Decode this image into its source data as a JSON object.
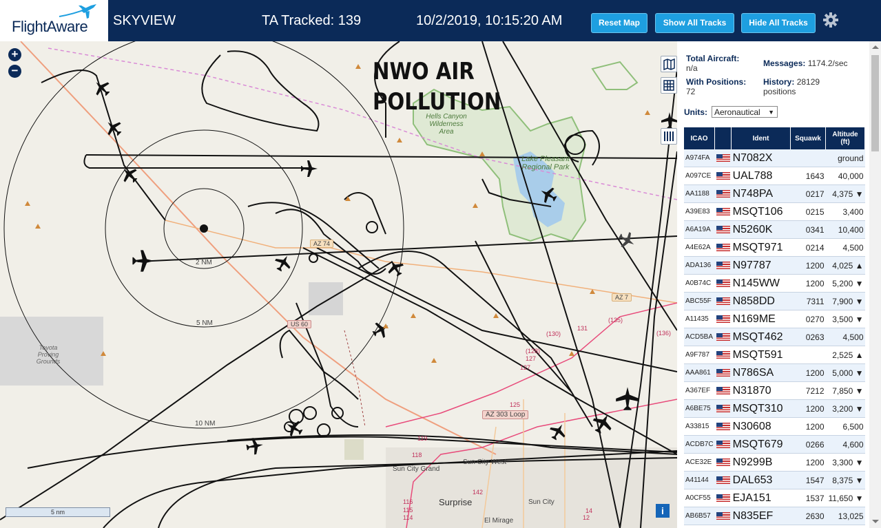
{
  "header": {
    "logo_text": "FlightAware",
    "site_name": "SKYVIEW",
    "tracked": "TA Tracked: 139",
    "datetime": "10/2/2019, 10:15:20 AM",
    "buttons": {
      "reset": "Reset Map",
      "show": "Show All Tracks",
      "hide": "Hide All Tracks"
    }
  },
  "map": {
    "zoom_in": "+",
    "zoom_out": "−",
    "overlay_line1": "NWO AIR",
    "overlay_line2": "POLLUTION",
    "ring_labels": {
      "r2": "2 NM",
      "r5": "5 NM",
      "r10": "10 NM"
    },
    "places": {
      "hells_canyon": "Hells Canyon Wilderness Area",
      "lake_pleasant": "Lake Pleasant Regional Park",
      "toyota": "Toyota Proving Grounds",
      "sun_city_grand": "Sun City Grand",
      "sun_city_west": "Sun City West",
      "sun_city": "Sun City",
      "surprise": "Surprise",
      "el_mirage": "El Mirage"
    },
    "roads": {
      "az74": "AZ 74",
      "az74b": "AZ 7",
      "us60": "US 60",
      "az303": "AZ 303 Loop",
      "r135": "(135)",
      "r131": "131",
      "r136": "(136)",
      "r130": "(130)",
      "r128": "(128)",
      "r127a": "127",
      "r127b": "127",
      "r125": "125",
      "r119": "119",
      "r118": "118",
      "r116": "116",
      "r115": "115",
      "r114": "114",
      "r142": "142",
      "r14": "14",
      "r12": "12"
    },
    "scale": "5 nm",
    "info": "i"
  },
  "panel": {
    "total_label": "Total Aircraft:",
    "total_value": "n/a",
    "messages_label": "Messages:",
    "messages_value": "1174.2/sec",
    "positions_label": "With Positions:",
    "positions_value": "72",
    "history_label": "History:",
    "history_value": "28129",
    "history_unit": "positions",
    "units_label": "Units:",
    "units_value": "Aeronautical",
    "columns": {
      "icao": "ICAO",
      "ident": "Ident",
      "squawk": "Squawk",
      "altitude": "Altitude",
      "alt_unit": "(ft)"
    },
    "rows": [
      {
        "icao": "A974FA",
        "ident": "N7082X",
        "squawk": "",
        "alt": "ground"
      },
      {
        "icao": "A097CE",
        "ident": "UAL788",
        "squawk": "1643",
        "alt": "40,000"
      },
      {
        "icao": "AA1188",
        "ident": "N748PA",
        "squawk": "0217",
        "alt": "4,375 ▼"
      },
      {
        "icao": "A39E83",
        "ident": "MSQT106",
        "squawk": "0215",
        "alt": "3,400"
      },
      {
        "icao": "A6A19A",
        "ident": "N5260K",
        "squawk": "0341",
        "alt": "10,400"
      },
      {
        "icao": "A4E62A",
        "ident": "MSQT971",
        "squawk": "0214",
        "alt": "4,500"
      },
      {
        "icao": "ADA136",
        "ident": "N97787",
        "squawk": "1200",
        "alt": "4,025 ▲"
      },
      {
        "icao": "A0B74C",
        "ident": "N145WW",
        "squawk": "1200",
        "alt": "5,200 ▼"
      },
      {
        "icao": "ABC55F",
        "ident": "N858DD",
        "squawk": "7311",
        "alt": "7,900 ▼"
      },
      {
        "icao": "A11435",
        "ident": "N169ME",
        "squawk": "0270",
        "alt": "3,500 ▼"
      },
      {
        "icao": "ACD5BA",
        "ident": "MSQT462",
        "squawk": "0263",
        "alt": "4,500"
      },
      {
        "icao": "A9F787",
        "ident": "MSQT591",
        "squawk": "",
        "alt": "2,525 ▲"
      },
      {
        "icao": "AAA861",
        "ident": "N786SA",
        "squawk": "1200",
        "alt": "5,000 ▼"
      },
      {
        "icao": "A367EF",
        "ident": "N31870",
        "squawk": "7212",
        "alt": "7,850 ▼"
      },
      {
        "icao": "A6BE75",
        "ident": "MSQT310",
        "squawk": "1200",
        "alt": "3,200 ▼"
      },
      {
        "icao": "A33815",
        "ident": "N30608",
        "squawk": "1200",
        "alt": "6,500"
      },
      {
        "icao": "ACDB7C",
        "ident": "MSQT679",
        "squawk": "0266",
        "alt": "4,600"
      },
      {
        "icao": "ACE32E",
        "ident": "N9299B",
        "squawk": "1200",
        "alt": "3,300 ▼"
      },
      {
        "icao": "A41144",
        "ident": "DAL653",
        "squawk": "1547",
        "alt": "8,375 ▼"
      },
      {
        "icao": "A0CF55",
        "ident": "EJA151",
        "squawk": "1537",
        "alt": "11,650 ▼"
      },
      {
        "icao": "AB6B57",
        "ident": "N835EF",
        "squawk": "2630",
        "alt": "13,025"
      }
    ]
  },
  "colors": {
    "header_bg": "#0b2a58",
    "button": "#1e9fe0",
    "map_bg": "#f1efe8",
    "lake": "#a9cdea",
    "park_border": "#8fbf7a",
    "row_alt": "#eaf2fb"
  }
}
